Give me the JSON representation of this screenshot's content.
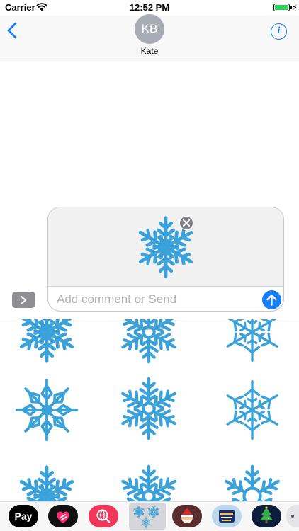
{
  "status_bar": {
    "carrier": "Carrier",
    "time": "12:52 PM",
    "battery_level": 1.0,
    "battery_color": "#2fd158"
  },
  "header": {
    "back_icon": "chevron-left-icon",
    "avatar_initials": "KB",
    "contact_name": "Kate",
    "info_label": "i",
    "accent_color": "#147efb"
  },
  "compose": {
    "preview_sticker": "snowflake-sticker",
    "remove_icon": "close-icon",
    "comment_placeholder": "Add comment or Send",
    "comment_value": "",
    "send_icon": "arrow-up-icon"
  },
  "drawer": {
    "sticker_color": "#3aa2d8",
    "stickers": [
      "snowflake-sticker-1",
      "snowflake-sticker-2",
      "snowflake-sticker-3",
      "snowflake-sticker-4",
      "snowflake-sticker-5",
      "snowflake-sticker-6",
      "snowflake-sticker-7",
      "snowflake-sticker-8",
      "snowflake-sticker-9"
    ]
  },
  "app_strip": {
    "apple_pay_label": "Pay",
    "apps": [
      "apple-pay",
      "digital-touch",
      "images-search",
      "snowflake-stickers",
      "santa-stickers",
      "happy-new-year-stickers",
      "christmas-tree-stickers",
      "more-apps"
    ]
  }
}
